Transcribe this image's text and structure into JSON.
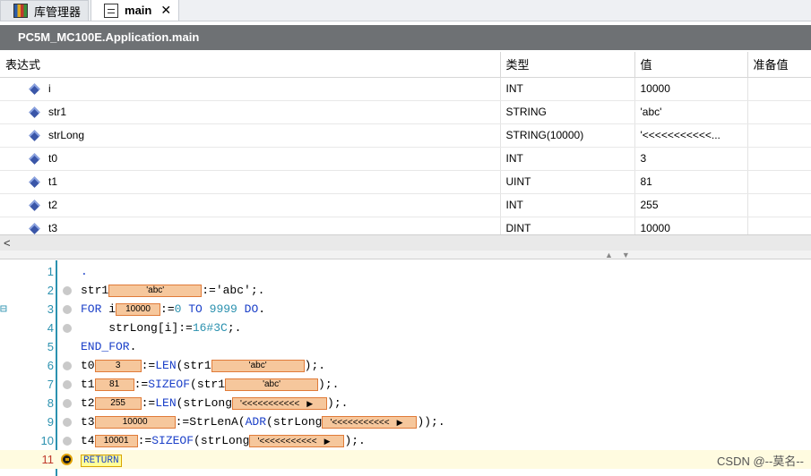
{
  "tabs": [
    {
      "label": "库管理器",
      "icon": "library-icon",
      "active": false
    },
    {
      "label": "main",
      "icon": "document-icon",
      "active": true,
      "closable": true
    }
  ],
  "header": {
    "title": "PC5M_MC100E.Application.main"
  },
  "watch": {
    "columns": [
      "表达式",
      "类型",
      "值",
      "准备值"
    ],
    "rows": [
      {
        "name": "i",
        "type": "INT",
        "value": "10000"
      },
      {
        "name": "str1",
        "type": "STRING",
        "value": "'abc'"
      },
      {
        "name": "strLong",
        "type": "STRING(10000)",
        "value": "'<<<<<<<<<<<..."
      },
      {
        "name": "t0",
        "type": "INT",
        "value": "3"
      },
      {
        "name": "t1",
        "type": "UINT",
        "value": "81"
      },
      {
        "name": "t2",
        "type": "INT",
        "value": "255"
      },
      {
        "name": "t3",
        "type": "DINT",
        "value": "10000"
      }
    ]
  },
  "scrollbar": {
    "left_arrow": "<",
    "grip": "▲▼"
  },
  "code": {
    "line_numbers": [
      "1",
      "2",
      "3",
      "4",
      "5",
      "6",
      "7",
      "8",
      "9",
      "10",
      "11"
    ],
    "fold_marker": "⊟",
    "l1": ".",
    "l2": {
      "pre": "str1",
      "box": "'abc'",
      "post": ":='abc';."
    },
    "l3": {
      "kw1": "FOR",
      "pre": " i",
      "box": "10000",
      "mid": ":=",
      "n1": "0",
      "kw2": " TO ",
      "n2": "9999",
      "kw3": " DO",
      "end": "."
    },
    "l4": {
      "pre": "    strLong[i]:=",
      "num": "16#3C",
      "post": ";."
    },
    "l5": {
      "kw": "END_FOR",
      "post": "."
    },
    "l6": {
      "pre": "t0",
      "box": "3",
      "mid": ":=",
      "fn": "LEN",
      "arg": "(str1",
      "box2": "'abc'",
      "post": ");."
    },
    "l7": {
      "pre": "t1",
      "box": "81",
      "mid": ":=",
      "fn": "SIZEOF",
      "arg": "(str1",
      "box2": "'abc'",
      "post": ");."
    },
    "l8": {
      "pre": "t2",
      "box": "255",
      "mid": ":=",
      "fn": "LEN",
      "arg": "(strLong",
      "box2": "'<<<<<<<<<<<",
      "post": ");."
    },
    "l9": {
      "pre": "t3",
      "box": "10000",
      "mid": ":=StrLenA(",
      "fn": "ADR",
      "arg": "(strLong",
      "box2": "'<<<<<<<<<<<",
      "post": "));."
    },
    "l10": {
      "pre": "t4",
      "box": "10001",
      "mid": ":=",
      "fn": "SIZEOF",
      "arg": "(strLong",
      "box2": "'<<<<<<<<<<<",
      "post": ");."
    },
    "l11": {
      "kw": "RETURN"
    }
  },
  "watermark": "CSDN @--莫名--"
}
